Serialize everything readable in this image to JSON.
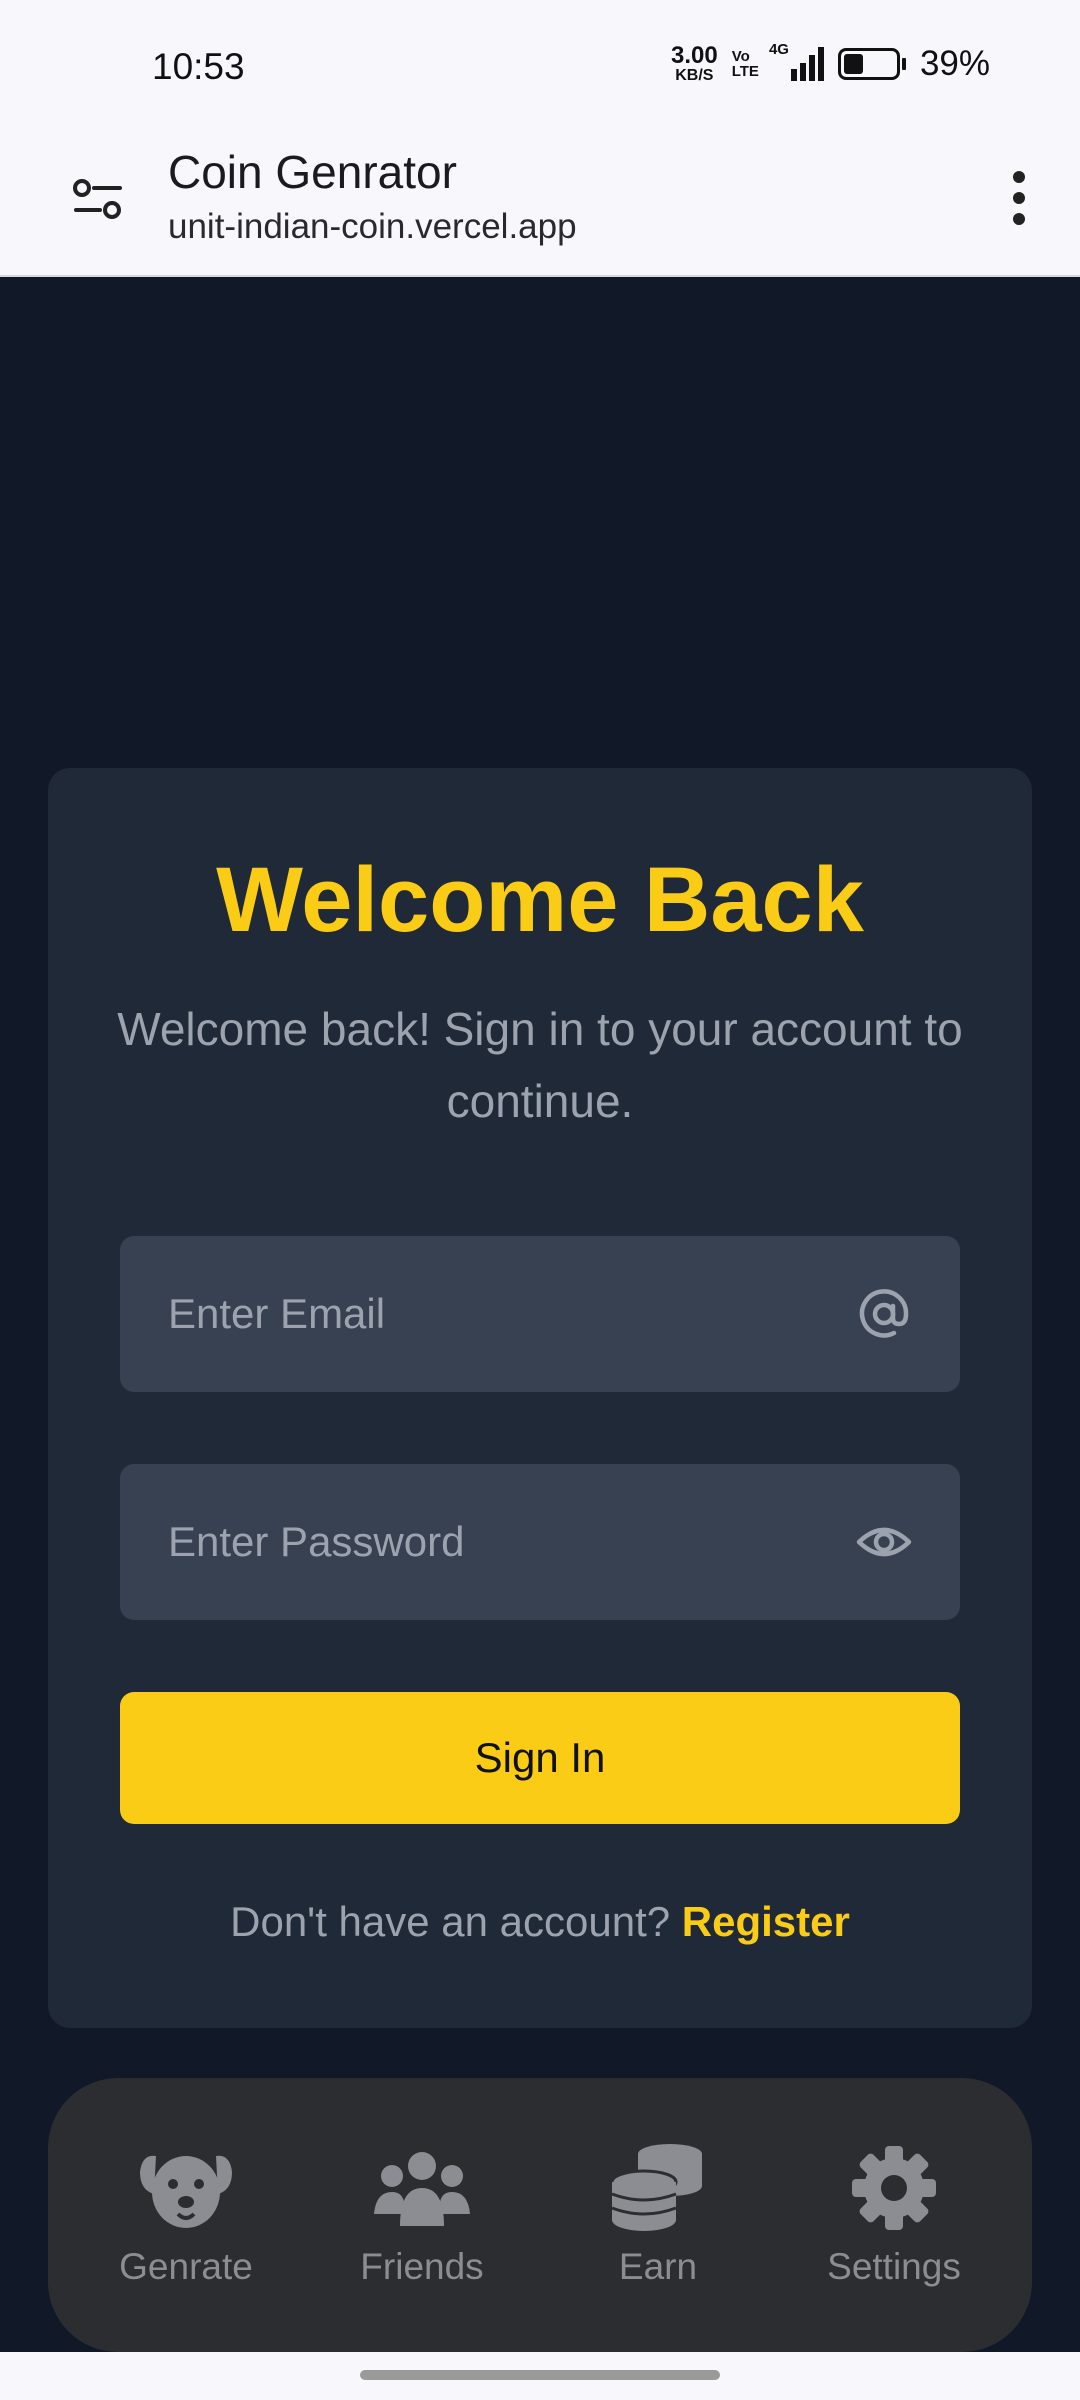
{
  "status_bar": {
    "time": "10:53",
    "net_speed_value": "3.00",
    "net_speed_unit": "KB/S",
    "volte_top": "Vo",
    "volte_bottom": "LTE",
    "network": "4G",
    "battery_percent": "39%",
    "battery_level": 0.39
  },
  "browser": {
    "title": "Coin Genrator",
    "url": "unit-indian-coin.vercel.app"
  },
  "login": {
    "title": "Welcome Back",
    "subtitle": "Welcome back! Sign in to your account to continue.",
    "email_placeholder": "Enter Email",
    "password_placeholder": "Enter Password",
    "signin_label": "Sign In",
    "no_account_text": "Don't have an account?",
    "register_label": "Register"
  },
  "nav": {
    "items": [
      {
        "label": "Genrate",
        "icon": "dog-icon"
      },
      {
        "label": "Friends",
        "icon": "users-icon"
      },
      {
        "label": "Earn",
        "icon": "coins-icon"
      },
      {
        "label": "Settings",
        "icon": "gear-icon"
      }
    ]
  },
  "colors": {
    "background": "#111827",
    "card": "#1f2937",
    "input": "#374151",
    "accent": "#facc15",
    "muted_text": "#9ca3af",
    "nav_background": "#2b2d31"
  }
}
